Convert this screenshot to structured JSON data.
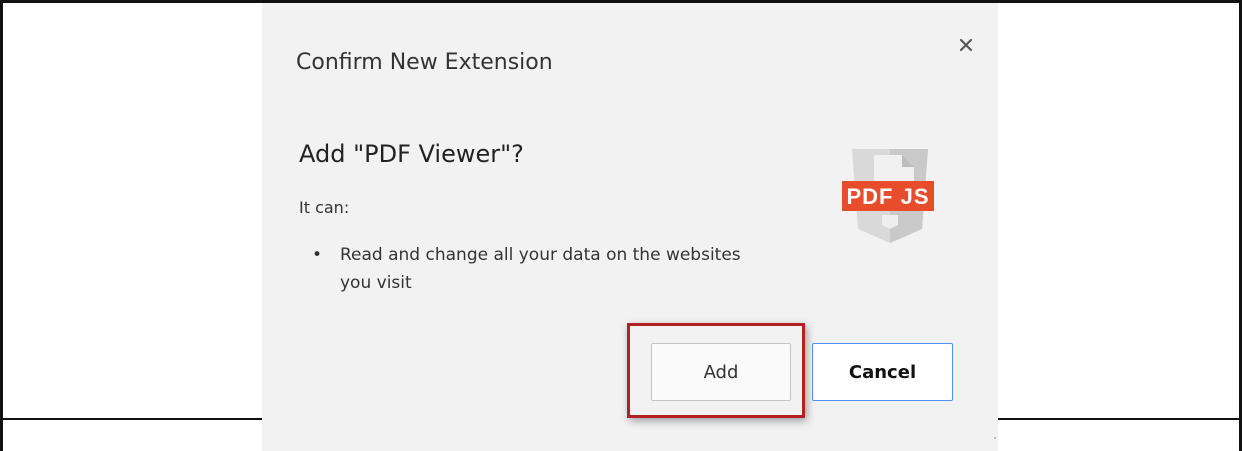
{
  "dialog": {
    "title": "Confirm New Extension",
    "close_icon": "close-icon",
    "heading": "Add \"PDF Viewer\"?",
    "permissions_label": "It can:",
    "permissions": [
      "Read and change all your data on the websites you visit"
    ],
    "logo": {
      "icon": "pdfjs-logo-icon",
      "text": "PDF JS",
      "colors": {
        "badge": "#e74c2b",
        "shield": "#d9d9d9",
        "shield_shade": "#c4c4c4"
      }
    },
    "buttons": {
      "add_label": "Add",
      "cancel_label": "Cancel"
    }
  },
  "colors": {
    "dialog_background": "#f2f2f2",
    "highlight_border": "#b22024",
    "focus_border": "#4d90fe"
  }
}
